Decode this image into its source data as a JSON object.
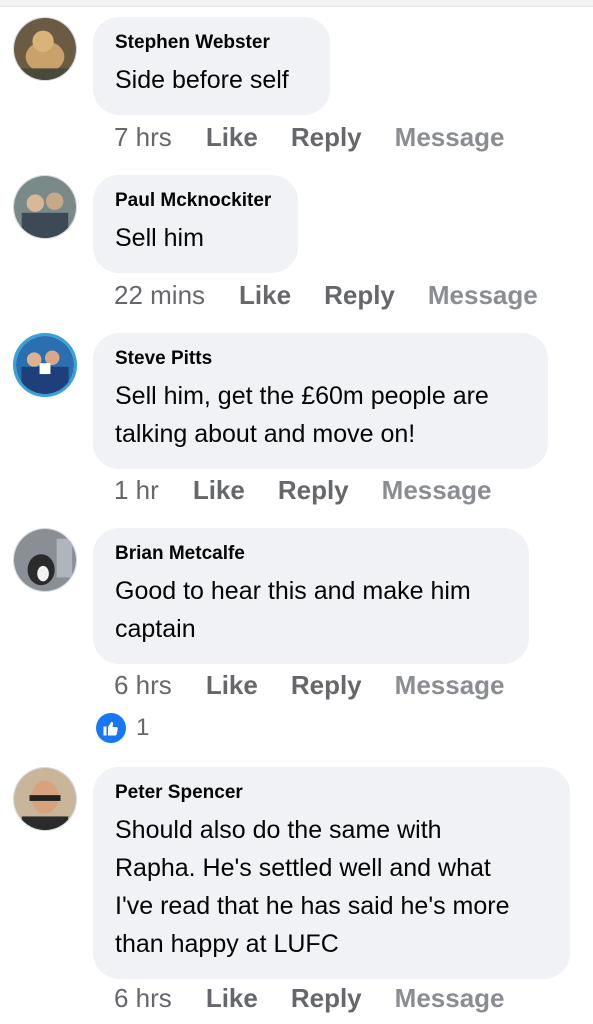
{
  "actions": {
    "like": "Like",
    "reply": "Reply",
    "message": "Message"
  },
  "comments": [
    {
      "author": "Stephen Webster",
      "lines": [
        "Side before self"
      ],
      "time": "7 hrs"
    },
    {
      "author": "Paul Mcknockiter",
      "lines": [
        "Sell him"
      ],
      "time": "22 mins"
    },
    {
      "author": "Steve Pitts",
      "lines": [
        "Sell him, get the £60m people are",
        "talking about and move on!"
      ],
      "time": "1 hr"
    },
    {
      "author": "Brian Metcalfe",
      "lines": [
        "Good to hear this and make him",
        "captain"
      ],
      "time": "6 hrs",
      "reaction": {
        "icon": "thumbs-up-icon",
        "count": "1"
      }
    },
    {
      "author": "Peter Spencer",
      "lines": [
        "Should also do the same with",
        "Rapha. He's settled well and what",
        "I've read that he has said he's more",
        "than happy at LUFC"
      ],
      "time": "6 hrs"
    }
  ],
  "colors": {
    "bubble": "#f0f2f5",
    "like_blue": "#1877f2",
    "meta_gray": "#65676b"
  }
}
